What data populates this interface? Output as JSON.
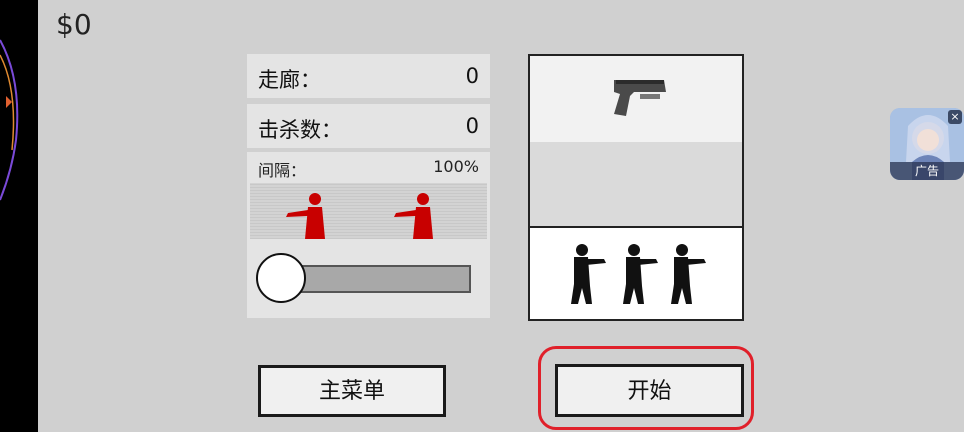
{
  "hud": {
    "money": "$0"
  },
  "stats": {
    "corridor_label": "走廊：",
    "corridor_value": "0",
    "kills_label": "击杀数：",
    "kills_value": "0"
  },
  "interval": {
    "label": "间隔：",
    "value": "100%",
    "slider_level_percent": 100
  },
  "weapon": {
    "icon": "pistol-icon"
  },
  "enemies": {
    "count": 3,
    "icon": "armed-enemy-silhouette"
  },
  "buttons": {
    "main_menu": "主菜单",
    "start": "开始"
  },
  "ad": {
    "label": "广告",
    "close": "×"
  },
  "colors": {
    "target_red": "#c80000",
    "highlight": "#e0202a",
    "background": "#d0d0d0"
  }
}
